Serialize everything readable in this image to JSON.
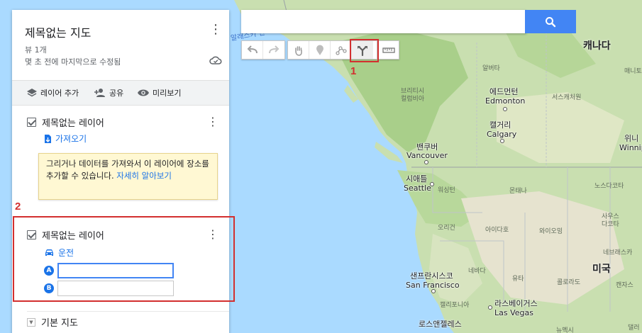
{
  "map": {
    "labels": {
      "canada": "캐나다",
      "usa": "미국",
      "alberta": "알버타",
      "edmonton_kr": "에드먼턴",
      "edmonton": "Edmonton",
      "calgary_kr": "캘거리",
      "calgary": "Calgary",
      "bc": "브리티시\n컬럼비아",
      "sask": "서스캐처원",
      "vancouver_kr": "밴쿠버",
      "vancouver": "Vancouver",
      "seattle_kr": "시애틀",
      "seattle": "Seattle",
      "washington": "워싱턴",
      "montana": "몬태나",
      "north_dakota": "노스다코타",
      "south_dakota": "사우스\n다코타",
      "oregon": "오리건",
      "idaho": "아이다호",
      "wyoming": "와이오밍",
      "nebraska": "네브래스카",
      "nevada": "네바다",
      "utah": "유타",
      "colorado": "콜로라도",
      "kansas": "캔자스",
      "sf_kr": "샌프란시스코",
      "sf": "San Francisco",
      "california": "캘리포니아",
      "vegas_kr": "라스베이거스",
      "vegas": "Las Vegas",
      "la_kr": "로스앤젤레스",
      "manitoba": "매니토",
      "winnipeg_kr": "위니",
      "winnipeg": "Winnip",
      "alaska_gulf": "알래스카 만",
      "new_mexico": "뉴멕시",
      "dallas": "댈러"
    }
  },
  "panel": {
    "title": "제목없는 지도",
    "views": "뷰 1개",
    "modified": "몇 초 전에 마지막으로 수정됨",
    "toolbar": {
      "add_layer": "레이어 추가",
      "share": "공유",
      "preview": "미리보기"
    },
    "layer1": {
      "title": "제목없는 레이어",
      "import": "가져오기",
      "hint": "그리거나 데이터를 가져와서 이 레이어에 장소를 추가할 수 있습니다. ",
      "hint_link": "자세히 알아보기"
    },
    "layer2": {
      "title": "제목없는 레이어",
      "mode": "운전",
      "marker_a": "A",
      "marker_b": "B",
      "input_a": "",
      "input_b": ""
    },
    "basemap": "기본 지도"
  },
  "search": {
    "value": "",
    "placeholder": ""
  },
  "annotations": {
    "num1": "1",
    "num2": "2"
  },
  "colors": {
    "accent": "#4285f4",
    "link": "#1a73e8",
    "annotation": "#d32f2f",
    "hint_bg": "#fff8d3"
  }
}
